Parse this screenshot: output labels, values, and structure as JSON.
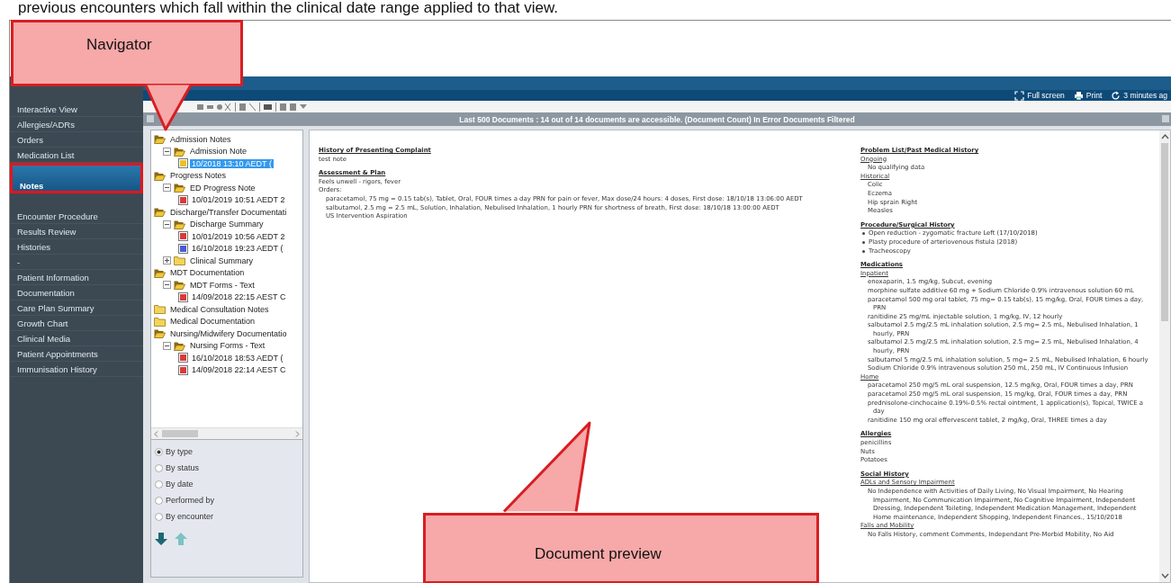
{
  "page_text": "previous encounters which fall within the clinical date range applied to that view.",
  "callouts": [
    {
      "kind": "navigator",
      "text": "Navigator"
    },
    {
      "kind": "preview",
      "text": "Document preview"
    }
  ],
  "header": {
    "links": [
      {
        "kind": "fullscreen",
        "label": "Full screen"
      },
      {
        "kind": "print",
        "label": "Print"
      },
      {
        "kind": "refresh",
        "label": "3 minutes ag"
      }
    ]
  },
  "document_bar": {
    "title": "Last 500 Documents : 14 out of 14 documents are accessible. (Document Count)  In Error Documents Filtered"
  },
  "sidebar": {
    "items": [
      {
        "label": "Interactive View",
        "selected": false,
        "annotated": false
      },
      {
        "label": "Allergies/ADRs",
        "selected": false,
        "annotated": false
      },
      {
        "label": "Orders",
        "selected": false,
        "annotated": false
      },
      {
        "label": "Medication List",
        "selected": false,
        "annotated": false
      },
      {
        "label": "Notes",
        "selected": true,
        "annotated": true
      },
      {
        "label": "Encounter Procedure",
        "selected": false,
        "annotated": false
      },
      {
        "label": "Results Review",
        "selected": false,
        "annotated": false
      },
      {
        "label": "Histories",
        "selected": false,
        "annotated": false
      },
      {
        "label": "-",
        "selected": false,
        "annotated": false
      },
      {
        "label": "Patient Information",
        "selected": false,
        "annotated": false
      },
      {
        "label": "Documentation",
        "selected": false,
        "annotated": false
      },
      {
        "label": "Care Plan Summary",
        "selected": false,
        "annotated": false
      },
      {
        "label": "Growth Chart",
        "selected": false,
        "annotated": false
      },
      {
        "label": "Clinical Media",
        "selected": false,
        "annotated": false
      },
      {
        "label": "Patient Appointments",
        "selected": false,
        "annotated": false
      },
      {
        "label": "Immunisation History",
        "selected": false,
        "annotated": false
      }
    ]
  },
  "tree": [
    {
      "kind": "folder",
      "label": "Admission Notes",
      "expanded": true,
      "children": [
        {
          "kind": "folder",
          "label": "Admission Note",
          "expanded": true,
          "children": [
            {
              "kind": "document",
              "label": "10/2018 13:10 AEDT (",
              "color": "#e8c22a",
              "selected": true
            }
          ]
        }
      ]
    },
    {
      "kind": "folder",
      "label": "Progress Notes",
      "expanded": true,
      "children": [
        {
          "kind": "folder",
          "label": "ED Progress Note",
          "expanded": true,
          "children": [
            {
              "kind": "document",
              "label": "10/01/2019 10:51 AEDT 2",
              "color": "#d93a3a",
              "selected": false
            }
          ]
        }
      ]
    },
    {
      "kind": "folder",
      "label": "Discharge/Transfer Documentati",
      "expanded": true,
      "children": [
        {
          "kind": "folder",
          "label": "Discharge Summary",
          "expanded": true,
          "children": [
            {
              "kind": "document",
              "label": "10/01/2019 10:56 AEDT 2",
              "color": "#d93a3a",
              "selected": false
            },
            {
              "kind": "document",
              "label": "16/10/2018 19:23 AEDT (",
              "color": "#4a5bd0",
              "selected": false
            }
          ]
        },
        {
          "kind": "folder",
          "label": "Clinical Summary",
          "expanded": false
        }
      ]
    },
    {
      "kind": "folder",
      "label": "MDT Documentation",
      "expanded": true,
      "children": [
        {
          "kind": "folder",
          "label": "MDT Forms - Text",
          "expanded": true,
          "children": [
            {
              "kind": "document",
              "label": "14/09/2018 22:15 AEST C",
              "color": "#d93a3a",
              "selected": false
            }
          ]
        }
      ]
    },
    {
      "kind": "folder",
      "label": "Medical Consultation Notes",
      "expanded": false
    },
    {
      "kind": "folder",
      "label": "Medical Documentation",
      "expanded": false
    },
    {
      "kind": "folder",
      "label": "Nursing/Midwifery Documentatio",
      "expanded": true,
      "children": [
        {
          "kind": "folder",
          "label": "Nursing Forms - Text",
          "expanded": true,
          "children": [
            {
              "kind": "document",
              "label": "16/10/2018 18:53 AEDT (",
              "color": "#d93a3a",
              "selected": false
            },
            {
              "kind": "document",
              "label": "14/09/2018 22:14 AEST C",
              "color": "#d93a3a",
              "selected": false
            }
          ]
        }
      ]
    }
  ],
  "group_by": [
    {
      "label": "By type",
      "selected": true
    },
    {
      "label": "By status",
      "selected": false
    },
    {
      "label": "By date",
      "selected": false
    },
    {
      "label": "Performed by",
      "selected": false
    },
    {
      "label": "By encounter",
      "selected": false
    }
  ],
  "preview": {
    "left": [
      {
        "kind": "heading",
        "text": "History of Presenting Complaint"
      },
      {
        "kind": "text",
        "text": "test note"
      },
      {
        "kind": "heading",
        "text": "Assessment & Plan"
      },
      {
        "kind": "text",
        "text": "Feels unwell - rigors, fever"
      },
      {
        "kind": "text",
        "text": "Orders:"
      },
      {
        "kind": "indent",
        "text": "paracetamol, 75 mg = 0.15 tab(s), Tablet, Oral, FOUR times a day PRN for pain or fever, Max dose/24 hours: 4 doses, First dose: 18/10/18 13:06:00 AEDT"
      },
      {
        "kind": "indent",
        "text": "salbutamol, 2.5 mg = 2.5 mL, Solution, Inhalation, Nebulised Inhalation, 1 hourly PRN for shortness of breath, First dose: 18/10/18 13:00:00 AEDT"
      },
      {
        "kind": "indent",
        "text": "US Intervention Aspiration"
      }
    ],
    "right": [
      {
        "kind": "heading",
        "text": "Problem List/Past Medical History"
      },
      {
        "kind": "subheading",
        "text": "Ongoing"
      },
      {
        "kind": "indent",
        "text": "No qualifying data"
      },
      {
        "kind": "subheading",
        "text": "Historical"
      },
      {
        "kind": "indent",
        "text": "Colic"
      },
      {
        "kind": "indent",
        "text": "Eczema"
      },
      {
        "kind": "indent",
        "text": "Hip sprain Right"
      },
      {
        "kind": "indent",
        "text": "Measles"
      },
      {
        "kind": "heading",
        "text": "Procedure/Surgical History"
      },
      {
        "kind": "bullet",
        "text": "Open reduction - zygomatic fracture Left (17/10/2018)"
      },
      {
        "kind": "bullet",
        "text": "Plasty procedure of arteriovenous fistula (2018)"
      },
      {
        "kind": "bullet",
        "text": "Tracheoscopy"
      },
      {
        "kind": "heading",
        "text": "Medications"
      },
      {
        "kind": "subheading",
        "text": "Inpatient"
      },
      {
        "kind": "indent",
        "text": "enoxaparin, 1.5 mg/kg, Subcut, evening"
      },
      {
        "kind": "indent",
        "text": "morphine sulfate additive 60 mg + Sodium Chloride 0.9% intravenous solution 60 mL"
      },
      {
        "kind": "indent",
        "text": "paracetamol 500 mg oral tablet, 75 mg= 0.15 tab(s), 15 mg/kg, Oral, FOUR times a day, PRN"
      },
      {
        "kind": "indent",
        "text": "ranitidine 25 mg/mL injectable solution, 1 mg/kg, IV, 12 hourly"
      },
      {
        "kind": "indent",
        "text": "salbutamol 2.5 mg/2.5 mL inhalation solution, 2.5 mg= 2.5 mL, Nebulised Inhalation, 1 hourly, PRN"
      },
      {
        "kind": "indent",
        "text": "salbutamol 2.5 mg/2.5 mL inhalation solution, 2.5 mg= 2.5 mL, Nebulised Inhalation, 4 hourly, PRN"
      },
      {
        "kind": "indent",
        "text": "salbutamol 5 mg/2.5 mL inhalation solution, 5 mg= 2.5 mL, Nebulised Inhalation, 6 hourly"
      },
      {
        "kind": "indent",
        "text": "Sodium Chloride 0.9% intravenous solution 250 mL, 250 mL, IV Continuous Infusion"
      },
      {
        "kind": "subheading",
        "text": "Home"
      },
      {
        "kind": "indent",
        "text": "paracetamol 250 mg/5 mL oral suspension, 12.5 mg/kg, Oral, FOUR times a day, PRN"
      },
      {
        "kind": "indent",
        "text": "paracetamol 250 mg/5 mL oral suspension, 15 mg/kg, Oral, FOUR times a day, PRN"
      },
      {
        "kind": "indent",
        "text": "prednisolone-cinchocaine 0.19%-0.5% rectal ointment, 1 application(s), Topical, TWICE a day"
      },
      {
        "kind": "indent",
        "text": "ranitidine 150 mg oral effervescent tablet, 2 mg/kg, Oral, THREE times a day"
      },
      {
        "kind": "heading",
        "text": "Allergies"
      },
      {
        "kind": "text",
        "text": "penicillins"
      },
      {
        "kind": "text",
        "text": "Nuts"
      },
      {
        "kind": "text",
        "text": "Potatoes"
      },
      {
        "kind": "heading",
        "text": "Social History"
      },
      {
        "kind": "subheading",
        "text": "ADLs and Sensory Impairment"
      },
      {
        "kind": "indent",
        "text": "No Independence with Activities of Daily Living, No Visual Impairment, No Hearing Impairment, No Communication Impairment, No Cognitive Impairment, Independent Dressing, Independent Toileting, Independent Medication Management, Independent Home maintenance, Independent Shopping, Independent Finances., 15/10/2018"
      },
      {
        "kind": "subheading",
        "text": "Falls and Mobility"
      },
      {
        "kind": "indent",
        "text": "No Falls History, comment Comments, Independant Pre-Morbid Mobility, No Aid"
      }
    ]
  }
}
